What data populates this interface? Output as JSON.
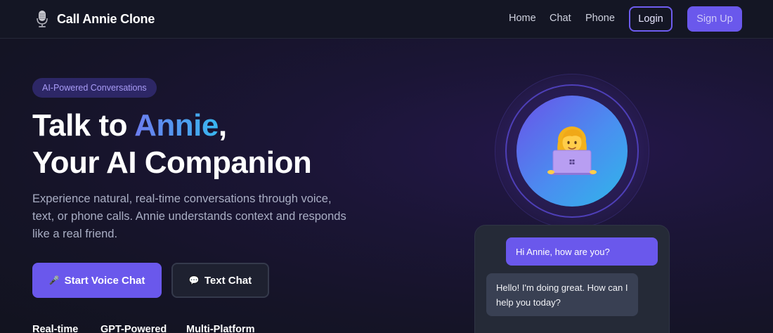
{
  "nav": {
    "brand_title": "Call Annie Clone",
    "brand_icon": "microphone-icon",
    "links": [
      "Home",
      "Chat",
      "Phone"
    ],
    "login_label": "Login",
    "signup_label": "Sign Up"
  },
  "hero": {
    "badge": "AI-Powered Conversations",
    "headline_part1": "Talk to ",
    "headline_accent": "Annie",
    "headline_part2": ",",
    "headline_line2": "Your AI Companion",
    "subtitle": "Experience natural, real-time conversations through voice, text, or phone calls. Annie understands context and responds like a real friend.",
    "primary_button": {
      "icon": "🎤",
      "label": "Start Voice Chat"
    },
    "secondary_button": {
      "icon": "💬",
      "label": "Text Chat"
    },
    "features": [
      "Real-time",
      "GPT-Powered",
      "Multi-Platform"
    ]
  },
  "avatar": {
    "icon": "woman-with-laptop-icon"
  },
  "chat_preview": {
    "user_message": "Hi Annie, how are you?",
    "bot_message": "Hello! I'm doing great. How can I help you today?"
  },
  "colors": {
    "accent": "#6a58ec",
    "background": "#151427",
    "nav_background": "#141624",
    "gradient_start": "#6d7cf0",
    "gradient_end": "#38b6ef"
  }
}
